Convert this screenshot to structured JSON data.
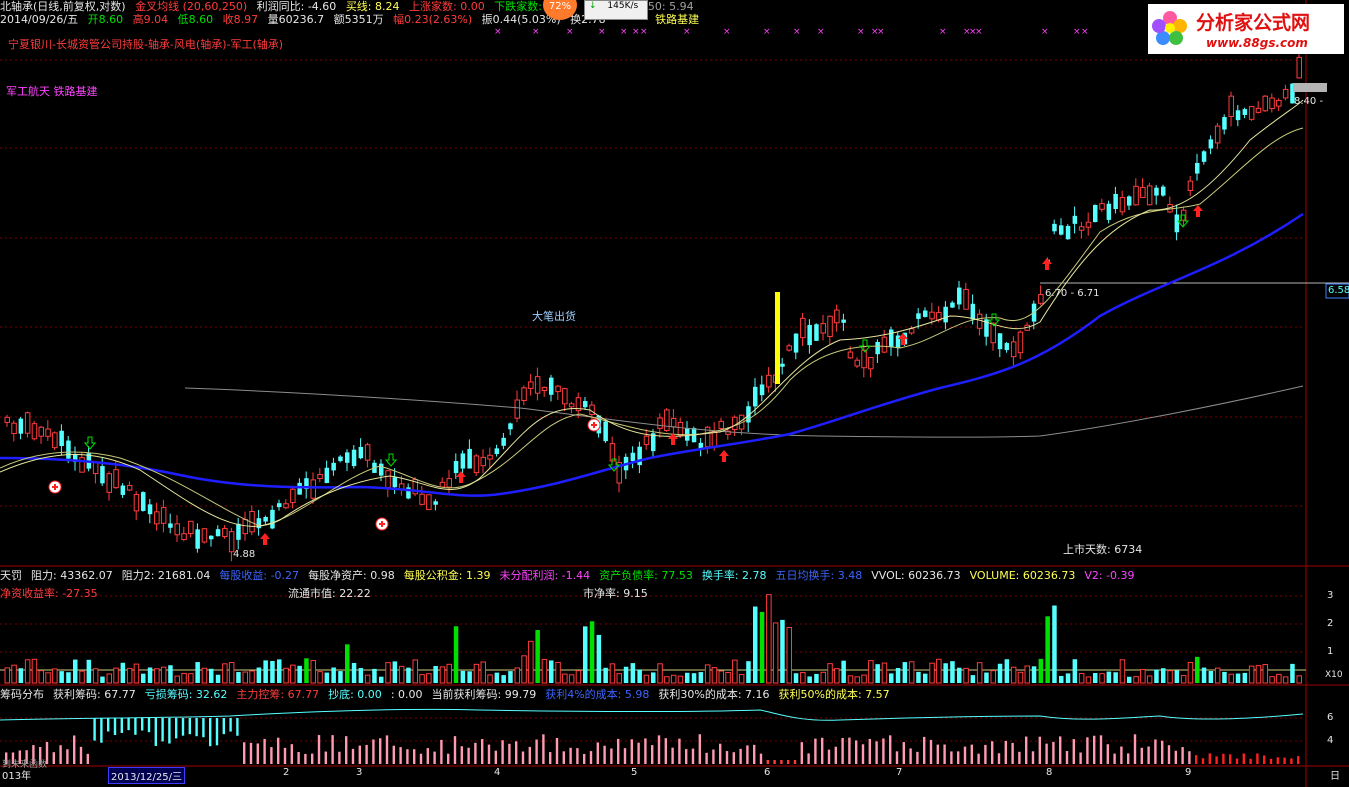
{
  "header": {
    "line1": {
      "title": "北轴承(日线,前复权,对数)",
      "ma_label": "金叉均线 (20,60,250)",
      "profit_ratio": "利润同比: -4.60",
      "buy_line": "买线: 8.24",
      "up_trend": "上涨家数: 0.00",
      "down_trend": "下跌家数: ",
      "ma250": "M250: 5.94"
    },
    "line2": {
      "date": "2014/09/26/五",
      "open": "开8.60",
      "high": "高9.04",
      "low": "低8.60",
      "close": "收8.97",
      "volume": "量60236.7",
      "amount": "额5351万",
      "change": "幅0.23(2.63%)",
      "amplitude": "振0.44(5.03%)",
      "turnover": "换2.78",
      "concept": "铁路基建"
    },
    "line3": "宁夏银川-长城资管公司持股-轴承-风电(轴承)-军工(轴承)",
    "concepts": "军工航天 铁路基建",
    "speed_badge": "145K/s",
    "pct_badge": "72%"
  },
  "logo": {
    "name": "分析家公式网",
    "url_text": "www.88gs.com"
  },
  "chart": {
    "annotation_big_sell": "大笔出货",
    "price_high_mark": "8.40 -",
    "price_mid_mark": "6.70 - 6.71",
    "price_low_mark": "4.88",
    "listing_days": "上市天数: 6734",
    "right_price_tag": "6.58"
  },
  "indicators": {
    "row1": [
      {
        "label": "天罚",
        "color": "white"
      },
      {
        "label": "阻力: 43362.07",
        "color": "white"
      },
      {
        "label": "阻力2: 21681.04",
        "color": "white"
      },
      {
        "label": "每股收益: -0.27",
        "color": "blue"
      },
      {
        "label": "每股净资产: 0.98",
        "color": "white"
      },
      {
        "label": "每股公积金: 1.39",
        "color": "yellow"
      },
      {
        "label": "未分配利润: -1.44",
        "color": "magenta"
      },
      {
        "label": "资产负债率: 77.53",
        "color": "green"
      },
      {
        "label": "换手率: 2.78",
        "color": "cyan"
      },
      {
        "label": "五日均换手: 3.48",
        "color": "blue"
      },
      {
        "label": "VVOL: 60236.73",
        "color": "white"
      },
      {
        "label": "VOLUME: 60236.73",
        "color": "yellow"
      },
      {
        "label": "V2: -0.39",
        "color": "magenta"
      }
    ],
    "row2_left": "净资收益率: -27.35",
    "row2_mid": "流通市值: 22.22",
    "row2_right": "市净率: 9.15",
    "vol_axis": [
      "3",
      "2",
      "1",
      "X10"
    ],
    "chip_row": [
      {
        "label": "筹码分布",
        "color": "white"
      },
      {
        "label": "获利筹码: 67.77",
        "color": "white"
      },
      {
        "label": "亏损筹码: 32.62",
        "color": "cyan"
      },
      {
        "label": "主力控筹: 67.77",
        "color": "red"
      },
      {
        "label": "抄底: 0.00",
        "color": "cyan"
      },
      {
        "label": ": 0.00",
        "color": "white"
      },
      {
        "label": "当前获利筹码: 99.79",
        "color": "white"
      },
      {
        "label": "获利4%的成本: 5.98",
        "color": "blue"
      },
      {
        "label": "获利30%的成本: 7.16",
        "color": "white"
      },
      {
        "label": "获利50%的成本: 7.57",
        "color": "yellow"
      }
    ],
    "chip_axis": [
      "6",
      "4"
    ]
  },
  "timeline": {
    "labels": [
      "013年",
      "2013/12/25/三",
      "2",
      "3",
      "4",
      "5",
      "6",
      "7",
      "8",
      "9",
      "日"
    ],
    "mini_hint": "到未来函数"
  },
  "colors": {
    "up": "#ff3c3c",
    "down": "#55ffff",
    "ma_blue": "#1e1eff",
    "ma_yellow": "#ffff80",
    "ma_gray": "#8c8c8c",
    "bg": "#000000"
  }
}
